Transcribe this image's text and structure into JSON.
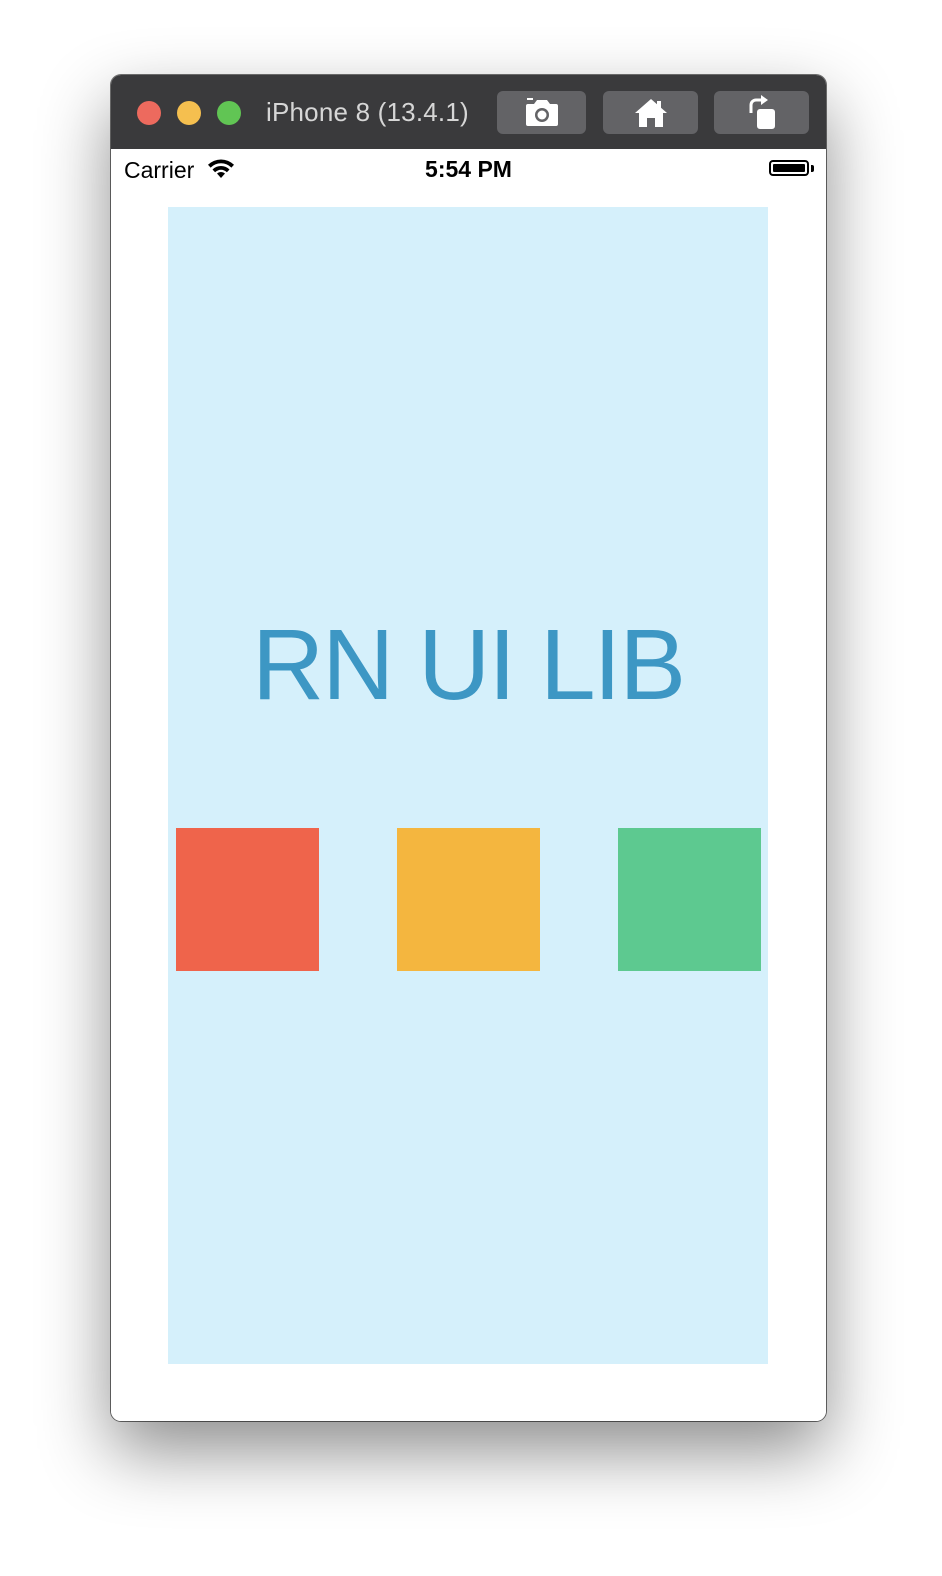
{
  "window": {
    "title": "iPhone 8 (13.4.1)",
    "traffic_lights": {
      "close_color": "#ed6a5e",
      "minimize_color": "#f5bf4f",
      "zoom_color": "#61c554"
    },
    "toolbar": {
      "screenshot_icon": "camera-icon",
      "home_icon": "home-icon",
      "rotate_icon": "rotate-icon"
    }
  },
  "status_bar": {
    "carrier": "Carrier",
    "time": "5:54 PM",
    "wifi_icon": "wifi-icon",
    "battery_icon": "battery-icon"
  },
  "app": {
    "background_color": "#d5f0fb",
    "title": "RN UI LIB",
    "title_color": "#3d97c4",
    "squares": [
      {
        "color": "#ef644b"
      },
      {
        "color": "#f4b63f"
      },
      {
        "color": "#5dc990"
      }
    ]
  }
}
